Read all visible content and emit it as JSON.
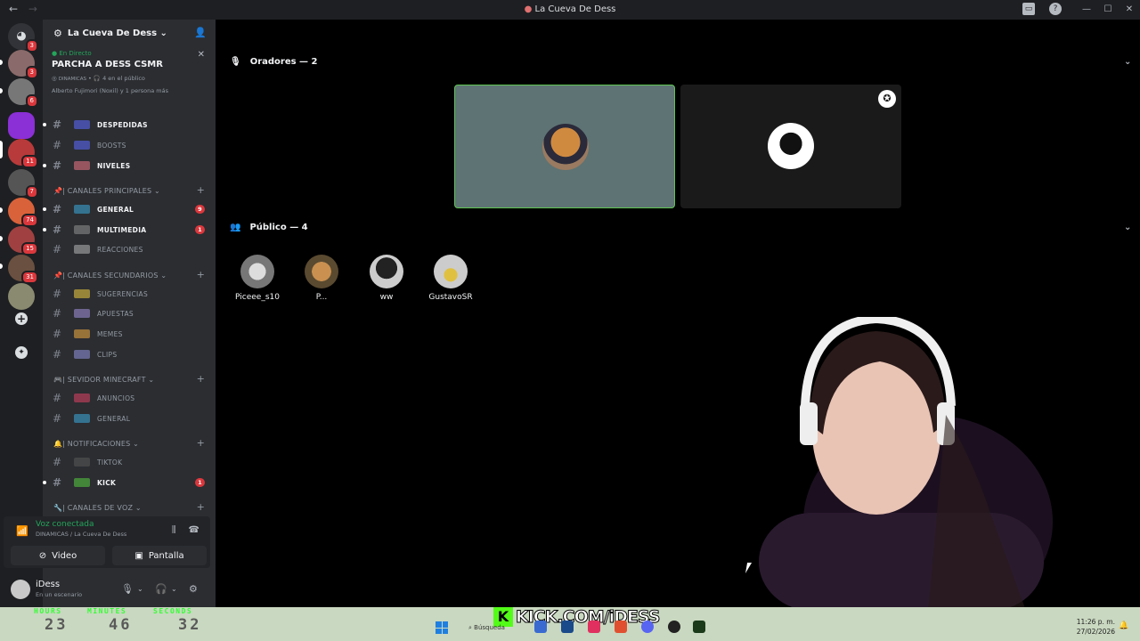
{
  "window": {
    "title": "La Cueva De Dess",
    "controls": [
      "—",
      "☐",
      "✕"
    ]
  },
  "server_badges": [
    "3",
    "3",
    "6",
    "11",
    "7",
    "74",
    "15",
    "31"
  ],
  "guild": {
    "name": "La Cueva De Dess ⌄"
  },
  "live": {
    "status": "En Directo",
    "stage_name": "PARCHA A DESS CSMR",
    "meta_channel": "DINAMICAS",
    "meta_listeners": "🎧 4 en el público",
    "meta_people": "Alberto Fujimori (Noxil) y 1 persona más"
  },
  "channels": [
    {
      "name": "DESPEDIDAS",
      "bold": true,
      "badge": ""
    },
    {
      "name": "BOOSTS",
      "bold": false,
      "badge": ""
    },
    {
      "name": "NIVELES",
      "bold": true,
      "badge": ""
    },
    {
      "name": "GENERAL",
      "bold": true,
      "badge": "9"
    },
    {
      "name": "MULTIMEDIA",
      "bold": true,
      "badge": "1"
    },
    {
      "name": "REACCIONES",
      "bold": false,
      "badge": ""
    },
    {
      "name": "SUGERENCIAS",
      "bold": false,
      "badge": ""
    },
    {
      "name": "APUESTAS",
      "bold": false,
      "badge": ""
    },
    {
      "name": "MEMES",
      "bold": false,
      "badge": ""
    },
    {
      "name": "CLIPS",
      "bold": false,
      "badge": ""
    },
    {
      "name": "ANUNCIOS",
      "bold": false,
      "badge": ""
    },
    {
      "name": "GENERAL",
      "bold": false,
      "badge": ""
    },
    {
      "name": "TIKTOK",
      "bold": false,
      "badge": ""
    },
    {
      "name": "KICK",
      "bold": true,
      "badge": "1"
    }
  ],
  "categories": {
    "principales": "| CANALES PRINCIPALES ⌄",
    "secundarios": "| CANALES SECUNDARIOS ⌄",
    "minecraft": "| SEVIDOR MINECRAFT ⌄",
    "notificaciones": "| NOTIFICACIONES ⌄",
    "voz": "| CANALES DE VOZ ⌄"
  },
  "voice": {
    "status": "Voz conectada",
    "location": "DINAMICAS / La Cueva De Dess",
    "video_label": "Video",
    "screen_label": "Pantalla"
  },
  "user": {
    "name": "iDess",
    "status": "En un escenario"
  },
  "stage": {
    "speakers_label": "Oradores — 2",
    "audience_label": "Público — 4",
    "audience": [
      "Piceee_s10",
      "P...",
      "ww",
      "GustavoSR"
    ]
  },
  "overlay": {
    "timer_labels": [
      "HOURS",
      "MINUTES",
      "SECONDS"
    ],
    "timer_values": [
      "23",
      "46",
      "32"
    ],
    "kick_text": "KICK.COM/iDESS"
  },
  "taskbar": {
    "search": "Búsqueda",
    "time": "11:26 p. m.",
    "date": "27/02/2026"
  },
  "colors": {
    "accent_green": "#23a55a",
    "kick_green": "#53fc18",
    "badge_red": "#da373c"
  }
}
